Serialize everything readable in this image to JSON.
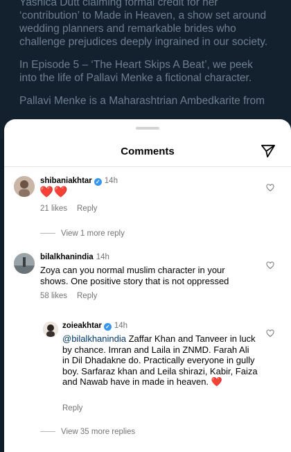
{
  "post": {
    "lines": [
      "Yashica Dutt claiming formal credit for her ‘contribution’ to Made in Heaven, a show set around wedding planners and remarkable brides who challenge prejudices deeply ingrained in our society.",
      "In Episode 5 – ‘The Heart Skips A Beat’, we peek into the life of Pallavi Menke a fictional character.",
      "Pallavi Menke is a Maharashtrian Ambedkarite from"
    ]
  },
  "sheet": {
    "title": "Comments"
  },
  "comments": [
    {
      "username": "shibaniakhtar",
      "time": "14h",
      "text": "❤️❤️",
      "likes": "21 likes",
      "reply_label": "Reply",
      "view_replies": "View 1 more reply"
    },
    {
      "username": "bilalkhanindia",
      "time": "14h",
      "text": "Zoya can you normal  muslim character in your shows. One positive story that is not oppressed",
      "likes": "58 likes",
      "reply_label": "Reply"
    }
  ],
  "reply": {
    "username": "zoieakhtar",
    "time": "14h",
    "mention": "@bilalkhanindia",
    "text": " Zaffar Khan and Tanveer in luck by chance. Imran and Laila in ZNMD. Farah Ali in Dil Dhadakne do. Practically everyone in gully boy. Sarfaraz khan and Leila shirazi, Kabir, Faiza and Nawab have in made in heaven. ❤️",
    "reply_label": "Reply",
    "view_replies": "View 35 more replies"
  },
  "icons": {
    "send": "send-icon",
    "like": "heart-outline-icon",
    "verified": "verified-badge-icon"
  },
  "colors": {
    "verified": "#3797f0",
    "mention": "#00376b",
    "heart": "#e0162b"
  }
}
